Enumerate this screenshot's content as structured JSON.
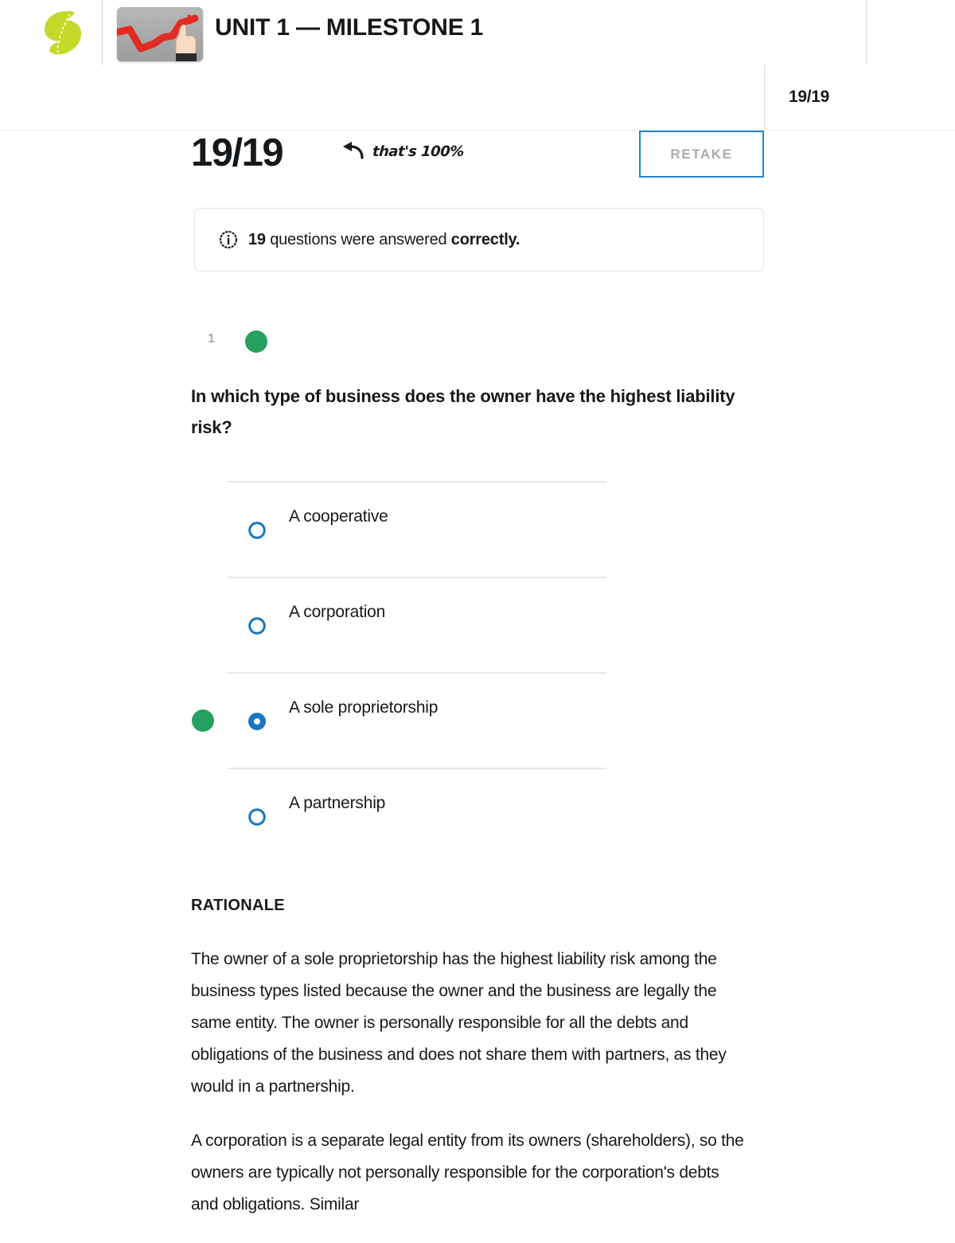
{
  "header": {
    "logo_icon": "sophia-s-logo",
    "thumbnail_icon": "chart-arrow-hand-thumbnail",
    "title": "UNIT 1 — MILESTONE 1"
  },
  "subheader": {
    "score": "19/19"
  },
  "score_row": {
    "score": "19/19",
    "percent_note": "that's 100%",
    "percent_arrow_icon": "curved-arrow-left-icon",
    "retake_label": "RETAKE"
  },
  "info_banner": {
    "icon": "info-circle-icon",
    "count": "19",
    "middle": " questions were answered ",
    "emphasis": "correctly."
  },
  "question": {
    "number": "1",
    "status_icon": "correct-green-dot",
    "text": "In which type of business does the owner have the highest liability risk?",
    "options": [
      {
        "label": "A cooperative",
        "selected": false,
        "correct": false
      },
      {
        "label": "A corporation",
        "selected": false,
        "correct": false
      },
      {
        "label": "A sole proprietorship",
        "selected": true,
        "correct": true
      },
      {
        "label": "A partnership",
        "selected": false,
        "correct": false
      }
    ]
  },
  "rationale": {
    "heading": "RATIONALE",
    "paragraphs": [
      "The owner of a sole proprietorship has the highest liability risk among the business types listed because the owner and the business are legally the same entity. The owner is personally responsible for all the debts and obligations of the business and does not share them with partners, as they would in a partnership.",
      "A corporation is a separate legal entity from its owners (shareholders), so the owners are typically not personally responsible for the corporation's debts and obligations. Similar"
    ]
  },
  "colors": {
    "brand_green_logo": "#c5d92d",
    "correct_green": "#26a05e",
    "radio_blue": "#1877c0",
    "retake_border_blue": "#2386c8",
    "retake_text_gray": "#a9acae",
    "rule_gray": "#e4e6e8"
  }
}
